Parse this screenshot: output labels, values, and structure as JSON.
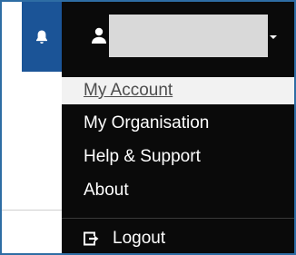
{
  "navbar": {
    "bell_icon": "bell-icon",
    "user_icon": "user-icon",
    "username": "",
    "caret_icon": "caret-down-icon",
    "colors": {
      "bell_bg": "#1b5497",
      "nav_bg": "#0a0a0a",
      "username_box": "#d9d9d9"
    }
  },
  "dropdown": {
    "items": [
      {
        "label": "My Account"
      },
      {
        "label": "My Organisation"
      },
      {
        "label": "Help & Support"
      },
      {
        "label": "About"
      }
    ],
    "logout": {
      "label": "Logout",
      "icon": "logout-icon"
    }
  }
}
